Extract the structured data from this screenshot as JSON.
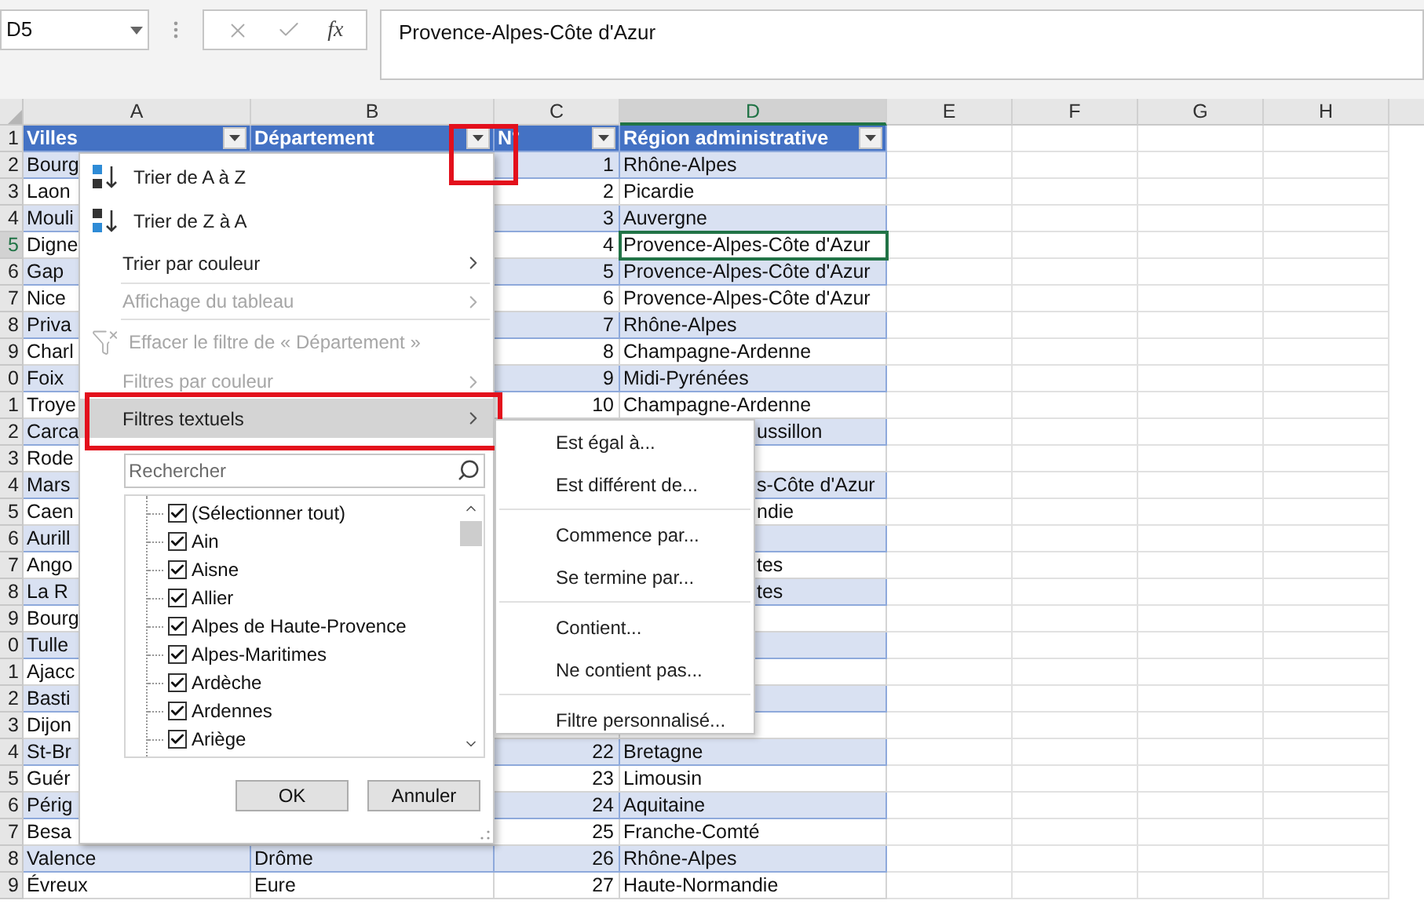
{
  "name_box": {
    "value": "D5"
  },
  "formula_bar": {
    "function_label": "fx",
    "value": "Provence-Alpes-Côte d'Azur"
  },
  "column_headers": [
    {
      "label": "A",
      "selected": false
    },
    {
      "label": "B",
      "selected": false
    },
    {
      "label": "C",
      "selected": false
    },
    {
      "label": "D",
      "selected": true
    },
    {
      "label": "E",
      "selected": false
    },
    {
      "label": "F",
      "selected": false
    },
    {
      "label": "G",
      "selected": false
    },
    {
      "label": "H",
      "selected": false
    }
  ],
  "rows": [
    {
      "number": "1",
      "kind": "header",
      "selected": false,
      "a": "Villes",
      "b": "Département",
      "c": "N°",
      "d": "Région administrative",
      "a_framed": false,
      "b_framed": true,
      "c_framed": false,
      "d_framed": false
    },
    {
      "number": "2",
      "kind": "data",
      "selected": false,
      "a": "Bourg",
      "c": "1",
      "d": "Rhône-Alpes"
    },
    {
      "number": "3",
      "kind": "data",
      "selected": false,
      "a": "Laon",
      "c": "2",
      "d": "Picardie"
    },
    {
      "number": "4",
      "kind": "data",
      "selected": false,
      "a": "Mouli",
      "c": "3",
      "d": "Auvergne"
    },
    {
      "number": "5",
      "kind": "data",
      "selected": true,
      "a": "Digne",
      "c": "4",
      "d": "Provence-Alpes-Côte d'Azur"
    },
    {
      "number": "6",
      "kind": "data",
      "selected": false,
      "a": "Gap",
      "c": "5",
      "d": "Provence-Alpes-Côte d'Azur"
    },
    {
      "number": "7",
      "kind": "data",
      "selected": false,
      "a": "Nice",
      "c": "6",
      "d": "Provence-Alpes-Côte d'Azur"
    },
    {
      "number": "8",
      "kind": "data",
      "selected": false,
      "a": "Priva",
      "c": "7",
      "d": "Rhône-Alpes"
    },
    {
      "number": "9",
      "kind": "data",
      "selected": false,
      "a": "Charl",
      "c": "8",
      "d": "Champagne-Ardenne"
    },
    {
      "number": "0",
      "kind": "data",
      "selected": false,
      "a": "Foix",
      "c": "9",
      "d": "Midi-Pyrénées"
    },
    {
      "number": "1",
      "kind": "data",
      "selected": false,
      "a": "Troye",
      "c": "10",
      "d": "Champagne-Ardenne"
    },
    {
      "number": "2",
      "kind": "data",
      "selected": false,
      "a": "Carca",
      "d_tail": "ussillon"
    },
    {
      "number": "3",
      "kind": "data",
      "selected": false,
      "a": "Rode"
    },
    {
      "number": "4",
      "kind": "data",
      "selected": false,
      "a": "Mars",
      "d_tail": "s-Côte d'Azur"
    },
    {
      "number": "5",
      "kind": "data",
      "selected": false,
      "a": "Caen",
      "d_tail": "ndie"
    },
    {
      "number": "6",
      "kind": "data",
      "selected": false,
      "a": "Aurill"
    },
    {
      "number": "7",
      "kind": "data",
      "selected": false,
      "a": "Ango",
      "d_tail": "tes"
    },
    {
      "number": "8",
      "kind": "data",
      "selected": false,
      "a": "La R",
      "d_tail": "tes"
    },
    {
      "number": "9",
      "kind": "data",
      "selected": false,
      "a": "Bourg"
    },
    {
      "number": "0",
      "kind": "data",
      "selected": false,
      "a": "Tulle"
    },
    {
      "number": "1",
      "kind": "data",
      "selected": false,
      "a": "Ajacc"
    },
    {
      "number": "2",
      "kind": "data",
      "selected": false,
      "a": "Basti"
    },
    {
      "number": "3",
      "kind": "data",
      "selected": false,
      "a": "Dijon"
    },
    {
      "number": "4",
      "kind": "data",
      "selected": false,
      "a": "St-Br",
      "c": "22",
      "d": "Bretagne"
    },
    {
      "number": "5",
      "kind": "data",
      "selected": false,
      "a": "Guér",
      "c": "23",
      "d": "Limousin"
    },
    {
      "number": "6",
      "kind": "data",
      "selected": false,
      "a": "Périg",
      "c": "24",
      "d": "Aquitaine"
    },
    {
      "number": "7",
      "kind": "data",
      "selected": false,
      "a": "Besa",
      "c": "25",
      "d": "Franche-Comté"
    },
    {
      "number": "8",
      "kind": "data",
      "selected": false,
      "a": "Valence",
      "b": "Drôme",
      "c": "26",
      "d": "Rhône-Alpes"
    },
    {
      "number": "9",
      "kind": "data",
      "selected": false,
      "a": "Évreux",
      "b": "Eure",
      "c": "27",
      "d": "Haute-Normandie"
    }
  ],
  "filter_menu": {
    "items": [
      {
        "kind": "sort_asc",
        "label": "Trier de A à Z",
        "disabled": false,
        "highlighted": false,
        "framed": false
      },
      {
        "kind": "sort_desc",
        "label": "Trier de Z à A",
        "disabled": false,
        "highlighted": false,
        "framed": false
      },
      {
        "kind": "submenu",
        "label": "Trier par couleur",
        "disabled": false,
        "highlighted": false,
        "framed": false
      },
      {
        "kind": "separator"
      },
      {
        "kind": "submenu",
        "label": "Affichage du tableau",
        "disabled": true,
        "highlighted": false,
        "framed": false
      },
      {
        "kind": "separator"
      },
      {
        "kind": "clear",
        "label": "Effacer le filtre de « Département »",
        "disabled": true,
        "highlighted": false,
        "framed": false
      },
      {
        "kind": "submenu",
        "label": "Filtres par couleur",
        "disabled": true,
        "highlighted": false,
        "framed": false
      },
      {
        "kind": "submenu",
        "label": "Filtres textuels",
        "disabled": false,
        "highlighted": true,
        "framed": true
      }
    ],
    "search": {
      "placeholder": "Rechercher"
    },
    "values": [
      {
        "label": "(Sélectionner tout)",
        "checked": true
      },
      {
        "label": "Ain",
        "checked": true
      },
      {
        "label": "Aisne",
        "checked": true
      },
      {
        "label": "Allier",
        "checked": true
      },
      {
        "label": "Alpes de Haute-Provence",
        "checked": true
      },
      {
        "label": "Alpes-Maritimes",
        "checked": true
      },
      {
        "label": "Ardèche",
        "checked": true
      },
      {
        "label": "Ardennes",
        "checked": true
      },
      {
        "label": "Ariège",
        "checked": true
      }
    ],
    "buttons": [
      "OK",
      "Annuler"
    ]
  },
  "text_filters_submenu": {
    "items": [
      {
        "kind": "item",
        "label": "Est égal à..."
      },
      {
        "kind": "item",
        "label": "Est différent de..."
      },
      {
        "kind": "separator"
      },
      {
        "kind": "item",
        "label": "Commence par..."
      },
      {
        "kind": "item",
        "label": "Se termine par..."
      },
      {
        "kind": "separator"
      },
      {
        "kind": "item",
        "label": "Contient..."
      },
      {
        "kind": "item",
        "label": "Ne contient pas..."
      },
      {
        "kind": "separator"
      },
      {
        "kind": "item",
        "label": "Filtre personnalisé..."
      }
    ]
  }
}
